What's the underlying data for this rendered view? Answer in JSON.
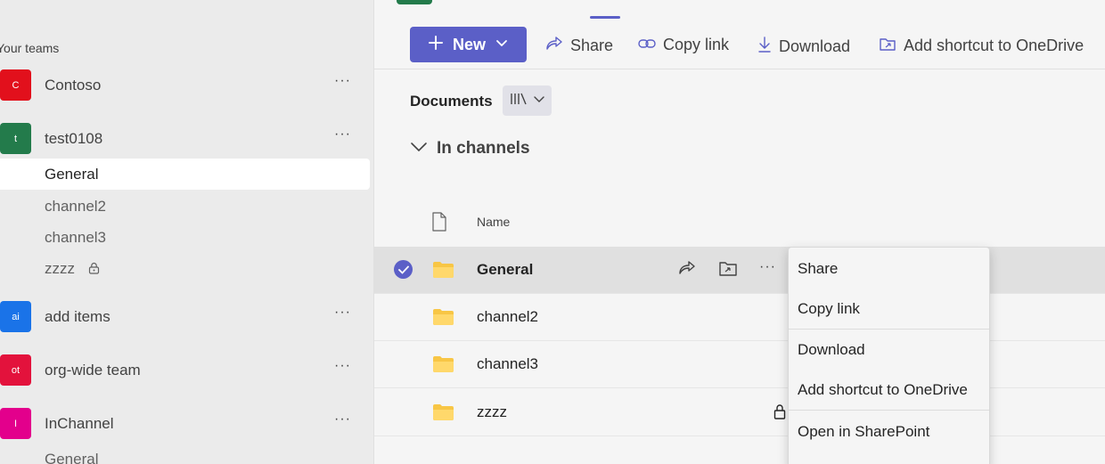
{
  "sidebar": {
    "section_label": "Your teams",
    "teams": [
      {
        "initials": "C",
        "name": "Contoso",
        "color": "#e2101c",
        "more": "···"
      },
      {
        "initials": "t",
        "name": "test0108",
        "color": "#237b4b",
        "more": "···"
      },
      {
        "initials": "ai",
        "name": "add items",
        "color": "#1a73e8",
        "more": "···"
      },
      {
        "initials": "ot",
        "name": "org-wide team",
        "color": "#e3123c",
        "more": "···"
      },
      {
        "initials": "I",
        "name": "InChannel",
        "color": "#e3008c",
        "more": "···"
      }
    ],
    "channels_test0108": [
      "General",
      "channel2",
      "channel3",
      "zzzz"
    ],
    "channels_inchannel": [
      "General"
    ]
  },
  "toolbar": {
    "new_label": "New",
    "share_label": "Share",
    "copy_link_label": "Copy link",
    "download_label": "Download",
    "add_shortcut_label": "Add shortcut to OneDrive"
  },
  "documents": {
    "title": "Documents",
    "group_label": "In channels",
    "column_name": "Name",
    "rows": [
      {
        "name": "General",
        "selected": true
      },
      {
        "name": "channel2",
        "selected": false
      },
      {
        "name": "channel3",
        "selected": false
      },
      {
        "name": "zzzz",
        "selected": false,
        "locked": true
      }
    ]
  },
  "context_menu": {
    "items": [
      "Share",
      "Copy link",
      "Download",
      "Add shortcut to OneDrive",
      "Open in SharePoint"
    ]
  },
  "colors": {
    "accent": "#5b5fc7",
    "folder": "#f8c645"
  }
}
